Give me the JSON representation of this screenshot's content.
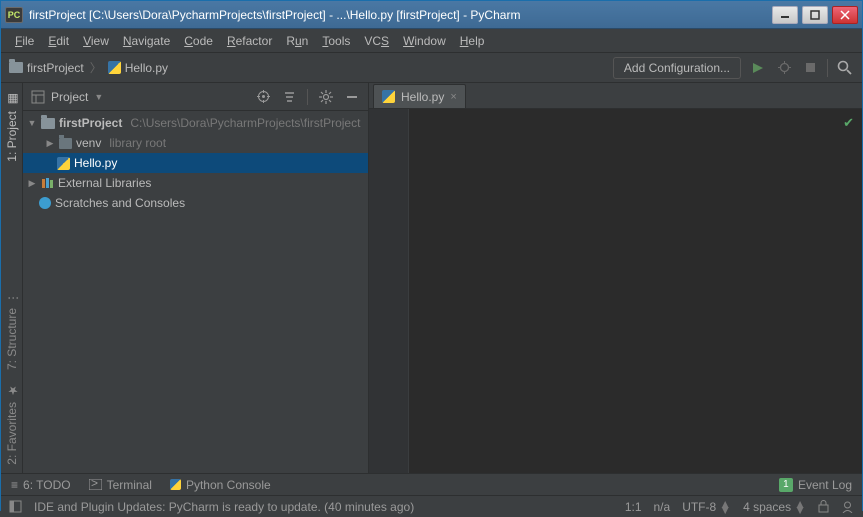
{
  "window": {
    "title": "firstProject [C:\\Users\\Dora\\PycharmProjects\\firstProject] - ...\\Hello.py [firstProject] - PyCharm"
  },
  "menu": [
    "File",
    "Edit",
    "View",
    "Navigate",
    "Code",
    "Refactor",
    "Run",
    "Tools",
    "VCS",
    "Window",
    "Help"
  ],
  "breadcrumb": {
    "project": "firstProject",
    "file": "Hello.py"
  },
  "nav": {
    "add_configuration": "Add Configuration..."
  },
  "left_gutter": {
    "tabs": [
      "1: Project",
      "7: Structure",
      "2: Favorites"
    ]
  },
  "project_panel": {
    "title": "Project"
  },
  "tree": {
    "root": {
      "name": "firstProject",
      "path": "C:\\Users\\Dora\\PycharmProjects\\firstProject"
    },
    "venv": {
      "name": "venv",
      "note": "library root"
    },
    "file": {
      "name": "Hello.py"
    },
    "ext": "External Libraries",
    "scratch": "Scratches and Consoles"
  },
  "editor": {
    "tabs": [
      {
        "label": "Hello.py"
      }
    ]
  },
  "bottom": {
    "todo": "6: TODO",
    "terminal": "Terminal",
    "console": "Python Console",
    "event_log": "Event Log",
    "event_count": "1"
  },
  "status": {
    "message": "IDE and Plugin Updates: PyCharm is ready to update. (40 minutes ago)",
    "pos": "1:1",
    "sep": "n/a",
    "encoding": "UTF-8",
    "indent": "4 spaces"
  },
  "colors": {
    "accent": "#0d4a7a",
    "bg": "#3c3f41",
    "editor": "#2b2b2b"
  }
}
